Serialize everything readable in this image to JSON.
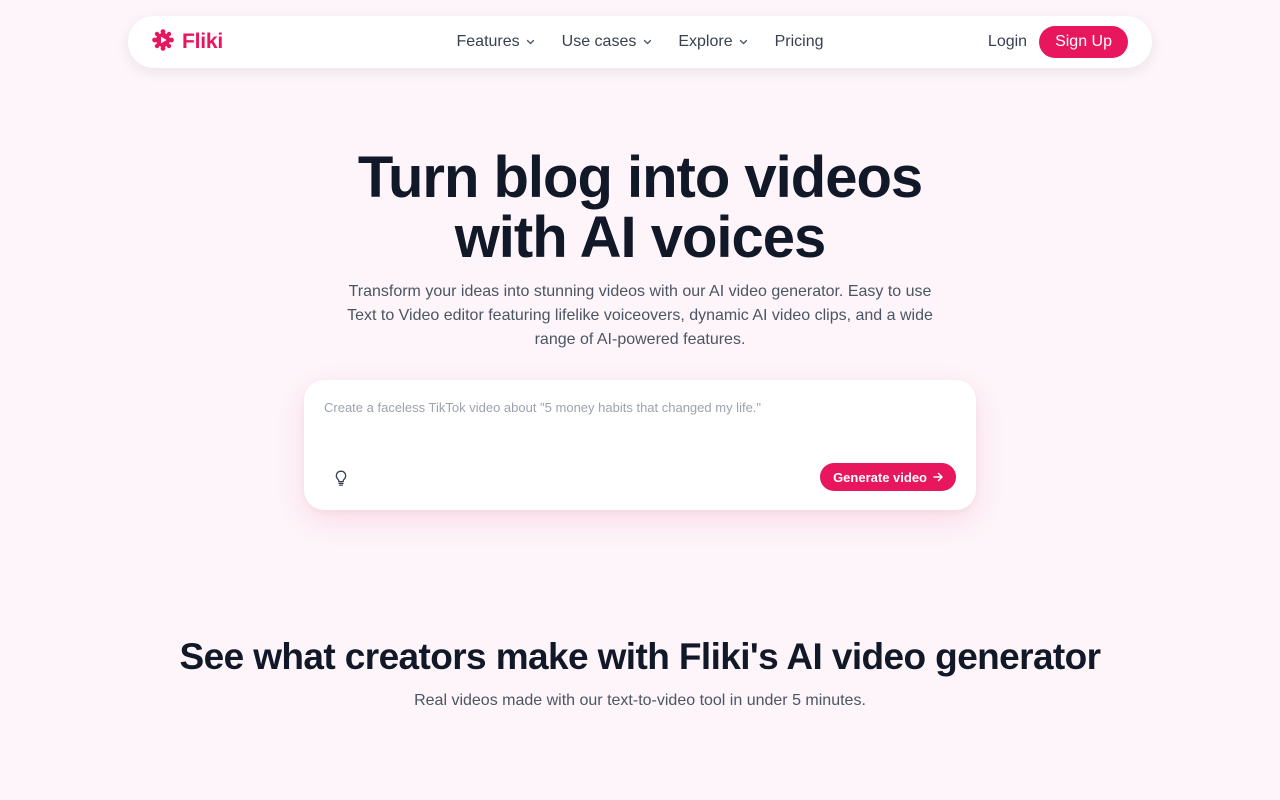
{
  "colors": {
    "brand": "#e8175d",
    "background": "#fdf5f9",
    "heading": "#111827",
    "body_text": "#4b5563"
  },
  "nav": {
    "brand": "Fliki",
    "links": [
      {
        "label": "Features",
        "has_dropdown": true
      },
      {
        "label": "Use cases",
        "has_dropdown": true
      },
      {
        "label": "Explore",
        "has_dropdown": true
      },
      {
        "label": "Pricing",
        "has_dropdown": false
      }
    ],
    "login": "Login",
    "signup": "Sign Up"
  },
  "hero": {
    "title_line1": "Turn blog into videos",
    "title_line2": "with AI voices",
    "subtitle": "Transform your ideas into stunning videos with our AI video generator. Easy to use Text to Video editor featuring lifelike voiceovers, dynamic AI video clips, and a wide range of AI-powered features."
  },
  "prompt": {
    "value": "",
    "placeholder": "Create a faceless TikTok video about \"5 money habits that changed my life.\"",
    "idea_icon": "lightbulb-icon",
    "generate_label": "Generate video"
  },
  "showcase": {
    "title": "See what creators make with Fliki's AI video generator",
    "subtitle": "Real videos made with our text-to-video tool in under 5 minutes."
  }
}
